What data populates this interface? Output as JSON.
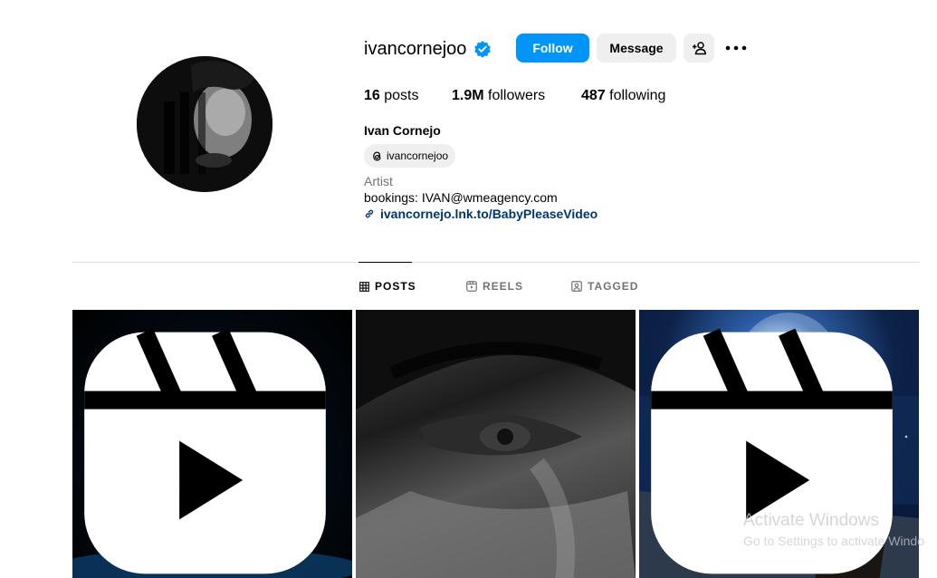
{
  "profile": {
    "username": "ivancornejoo",
    "follow_label": "Follow",
    "message_label": "Message",
    "stats": {
      "posts_count": "16",
      "posts_label": "posts",
      "followers_count": "1.9M",
      "followers_label": "followers",
      "following_count": "487",
      "following_label": "following"
    },
    "full_name": "Ivan Cornejo",
    "threads_handle": "ivancornejoo",
    "category": "Artist",
    "bio": "bookings: IVAN@wmeagency.com",
    "link": "ivancornejo.lnk.to/BabyPleaseVideo"
  },
  "tabs": [
    {
      "label": "POSTS",
      "icon": "grid-icon",
      "active": true
    },
    {
      "label": "REELS",
      "icon": "reels-icon",
      "active": false
    },
    {
      "label": "TAGGED",
      "icon": "tagged-icon",
      "active": false
    }
  ],
  "posts": [
    {
      "type": "reel",
      "icon": "reel-icon"
    },
    {
      "type": "image"
    },
    {
      "type": "reel",
      "icon": "reel-icon"
    }
  ],
  "watermark": {
    "line1": "Activate Windows",
    "line2": "Go to Settings to activate Windo"
  },
  "colors": {
    "accent": "#0095f6",
    "secondary_button": "#efefef",
    "link": "#00376b",
    "muted_text": "#737373",
    "divider": "#dbdbdb"
  }
}
